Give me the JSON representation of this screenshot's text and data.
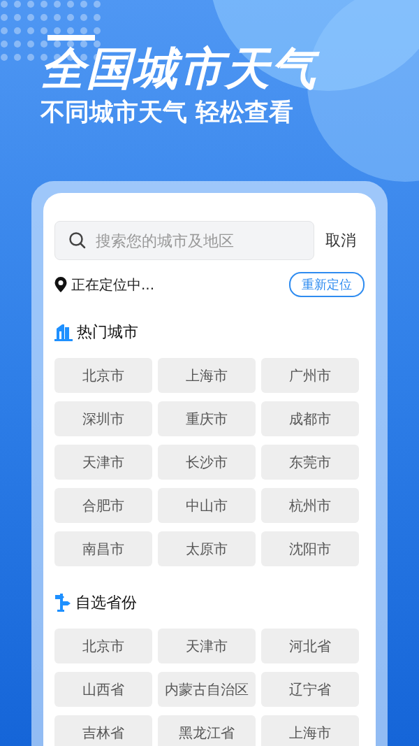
{
  "banner": {
    "title": "全国城市天气",
    "subtitle": "不同城市天气 轻松查看"
  },
  "search": {
    "placeholder": "搜索您的城市及地区",
    "cancel": "取消"
  },
  "location": {
    "status": "正在定位中...",
    "relocate": "重新定位"
  },
  "sections": [
    {
      "kind": "hot",
      "title": "热门城市",
      "items": [
        "北京市",
        "上海市",
        "广州市",
        "深圳市",
        "重庆市",
        "成都市",
        "天津市",
        "长沙市",
        "东莞市",
        "合肥市",
        "中山市",
        "杭州市",
        "南昌市",
        "太原市",
        "沈阳市"
      ]
    },
    {
      "kind": "province",
      "title": "自选省份",
      "items": [
        "北京市",
        "天津市",
        "河北省",
        "山西省",
        "内蒙古自治区",
        "辽宁省",
        "吉林省",
        "黑龙江省",
        "上海市"
      ]
    }
  ]
}
